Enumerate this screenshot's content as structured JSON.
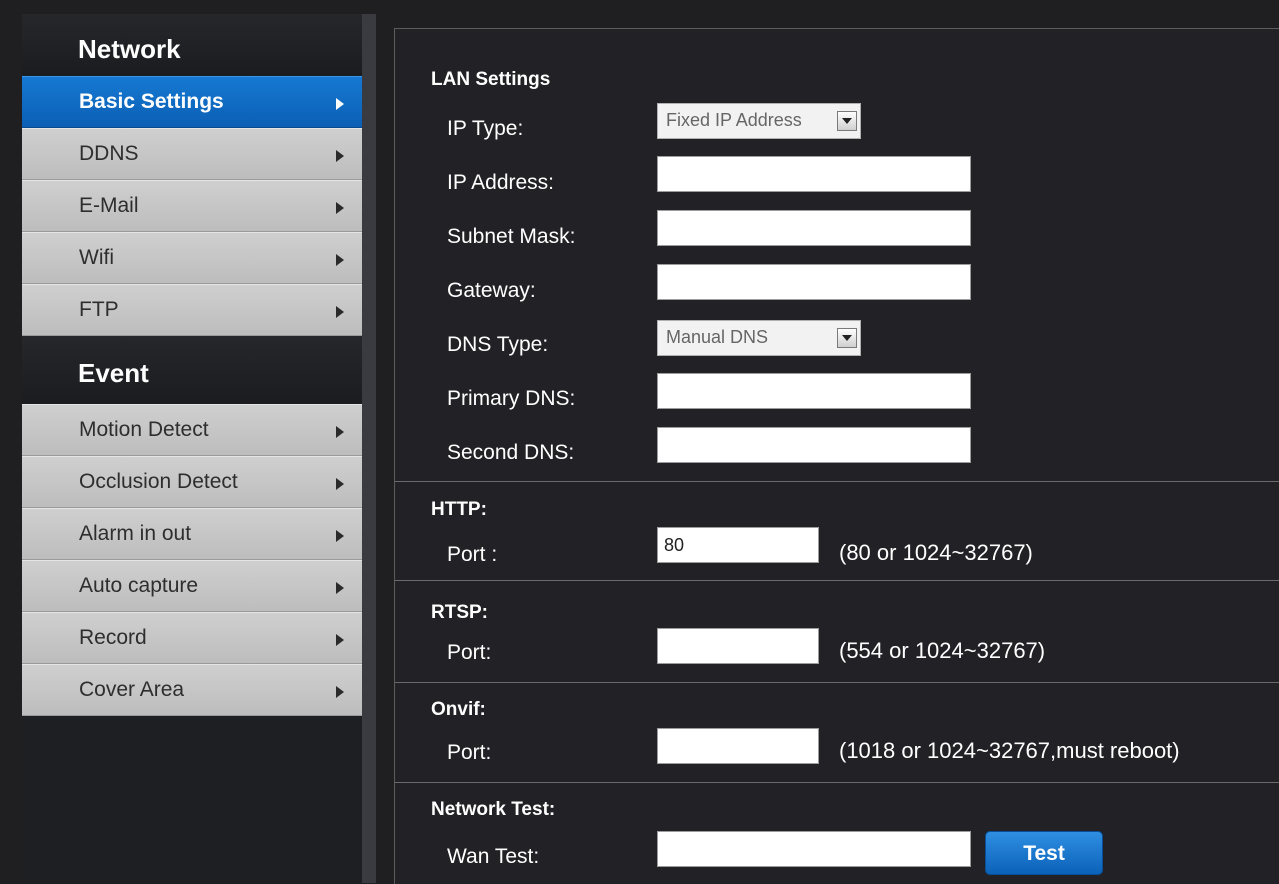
{
  "sidebar": {
    "network_title": "Network",
    "network_items": [
      {
        "label": "Basic Settings",
        "active": true
      },
      {
        "label": "DDNS"
      },
      {
        "label": "E-Mail"
      },
      {
        "label": "Wifi"
      },
      {
        "label": "FTP"
      }
    ],
    "event_title": "Event",
    "event_items": [
      {
        "label": "Motion Detect"
      },
      {
        "label": "Occlusion Detect"
      },
      {
        "label": "Alarm in out"
      },
      {
        "label": "Auto capture"
      },
      {
        "label": "Record"
      },
      {
        "label": "Cover Area"
      }
    ]
  },
  "lan": {
    "title": "LAN Settings",
    "ip_type_label": "IP Type:",
    "ip_type_value": "Fixed IP Address",
    "ip_address_label": "IP Address:",
    "ip_address_value": "",
    "subnet_label": "Subnet Mask:",
    "subnet_value": "",
    "gateway_label": "Gateway:",
    "gateway_value": "",
    "dns_type_label": "DNS Type:",
    "dns_type_value": "Manual DNS",
    "primary_dns_label": "Primary DNS:",
    "primary_dns_value": "",
    "second_dns_label": "Second DNS:",
    "second_dns_value": ""
  },
  "http": {
    "title": "HTTP:",
    "port_label": "Port :",
    "port_value": "80",
    "hint": "(80 or 1024~32767)"
  },
  "rtsp": {
    "title": "RTSP:",
    "port_label": "Port:",
    "port_value": "",
    "hint": "(554 or 1024~32767)"
  },
  "onvif": {
    "title": "Onvif:",
    "port_label": "Port:",
    "port_value": "",
    "hint": "(1018 or 1024~32767,must reboot)"
  },
  "network_test": {
    "title": "Network Test:",
    "wan_label": "Wan Test:",
    "wan_value": "",
    "button_label": "Test"
  },
  "colors": {
    "accent": "#0b6cc6",
    "background": "#1f1f22",
    "nav_item": "#c6c6c6"
  }
}
